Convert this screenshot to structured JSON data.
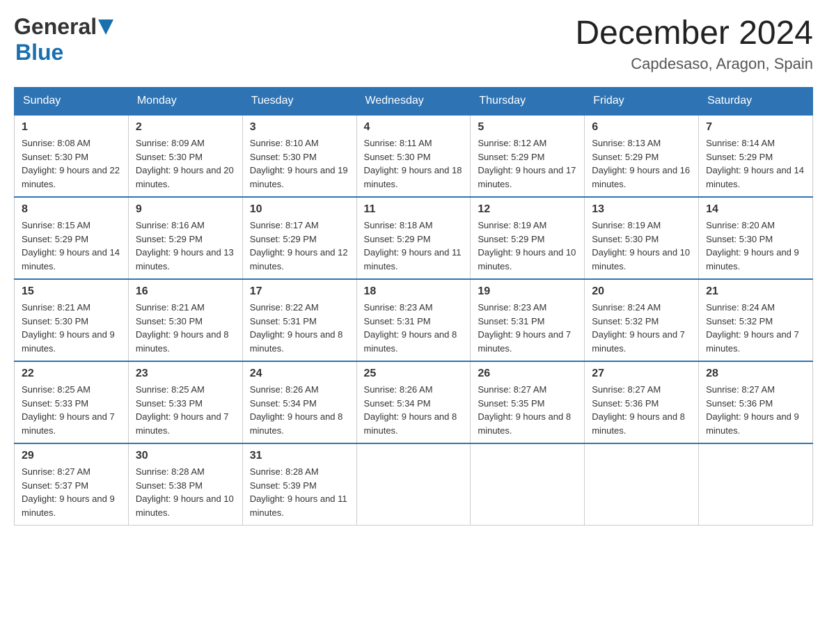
{
  "header": {
    "logo_general": "General",
    "logo_blue": "Blue",
    "month_title": "December 2024",
    "location": "Capdesaso, Aragon, Spain"
  },
  "weekdays": [
    "Sunday",
    "Monday",
    "Tuesday",
    "Wednesday",
    "Thursday",
    "Friday",
    "Saturday"
  ],
  "weeks": [
    [
      {
        "day": "1",
        "sunrise": "8:08 AM",
        "sunset": "5:30 PM",
        "daylight": "9 hours and 22 minutes."
      },
      {
        "day": "2",
        "sunrise": "8:09 AM",
        "sunset": "5:30 PM",
        "daylight": "9 hours and 20 minutes."
      },
      {
        "day": "3",
        "sunrise": "8:10 AM",
        "sunset": "5:30 PM",
        "daylight": "9 hours and 19 minutes."
      },
      {
        "day": "4",
        "sunrise": "8:11 AM",
        "sunset": "5:30 PM",
        "daylight": "9 hours and 18 minutes."
      },
      {
        "day": "5",
        "sunrise": "8:12 AM",
        "sunset": "5:29 PM",
        "daylight": "9 hours and 17 minutes."
      },
      {
        "day": "6",
        "sunrise": "8:13 AM",
        "sunset": "5:29 PM",
        "daylight": "9 hours and 16 minutes."
      },
      {
        "day": "7",
        "sunrise": "8:14 AM",
        "sunset": "5:29 PM",
        "daylight": "9 hours and 14 minutes."
      }
    ],
    [
      {
        "day": "8",
        "sunrise": "8:15 AM",
        "sunset": "5:29 PM",
        "daylight": "9 hours and 14 minutes."
      },
      {
        "day": "9",
        "sunrise": "8:16 AM",
        "sunset": "5:29 PM",
        "daylight": "9 hours and 13 minutes."
      },
      {
        "day": "10",
        "sunrise": "8:17 AM",
        "sunset": "5:29 PM",
        "daylight": "9 hours and 12 minutes."
      },
      {
        "day": "11",
        "sunrise": "8:18 AM",
        "sunset": "5:29 PM",
        "daylight": "9 hours and 11 minutes."
      },
      {
        "day": "12",
        "sunrise": "8:19 AM",
        "sunset": "5:29 PM",
        "daylight": "9 hours and 10 minutes."
      },
      {
        "day": "13",
        "sunrise": "8:19 AM",
        "sunset": "5:30 PM",
        "daylight": "9 hours and 10 minutes."
      },
      {
        "day": "14",
        "sunrise": "8:20 AM",
        "sunset": "5:30 PM",
        "daylight": "9 hours and 9 minutes."
      }
    ],
    [
      {
        "day": "15",
        "sunrise": "8:21 AM",
        "sunset": "5:30 PM",
        "daylight": "9 hours and 9 minutes."
      },
      {
        "day": "16",
        "sunrise": "8:21 AM",
        "sunset": "5:30 PM",
        "daylight": "9 hours and 8 minutes."
      },
      {
        "day": "17",
        "sunrise": "8:22 AM",
        "sunset": "5:31 PM",
        "daylight": "9 hours and 8 minutes."
      },
      {
        "day": "18",
        "sunrise": "8:23 AM",
        "sunset": "5:31 PM",
        "daylight": "9 hours and 8 minutes."
      },
      {
        "day": "19",
        "sunrise": "8:23 AM",
        "sunset": "5:31 PM",
        "daylight": "9 hours and 7 minutes."
      },
      {
        "day": "20",
        "sunrise": "8:24 AM",
        "sunset": "5:32 PM",
        "daylight": "9 hours and 7 minutes."
      },
      {
        "day": "21",
        "sunrise": "8:24 AM",
        "sunset": "5:32 PM",
        "daylight": "9 hours and 7 minutes."
      }
    ],
    [
      {
        "day": "22",
        "sunrise": "8:25 AM",
        "sunset": "5:33 PM",
        "daylight": "9 hours and 7 minutes."
      },
      {
        "day": "23",
        "sunrise": "8:25 AM",
        "sunset": "5:33 PM",
        "daylight": "9 hours and 7 minutes."
      },
      {
        "day": "24",
        "sunrise": "8:26 AM",
        "sunset": "5:34 PM",
        "daylight": "9 hours and 8 minutes."
      },
      {
        "day": "25",
        "sunrise": "8:26 AM",
        "sunset": "5:34 PM",
        "daylight": "9 hours and 8 minutes."
      },
      {
        "day": "26",
        "sunrise": "8:27 AM",
        "sunset": "5:35 PM",
        "daylight": "9 hours and 8 minutes."
      },
      {
        "day": "27",
        "sunrise": "8:27 AM",
        "sunset": "5:36 PM",
        "daylight": "9 hours and 8 minutes."
      },
      {
        "day": "28",
        "sunrise": "8:27 AM",
        "sunset": "5:36 PM",
        "daylight": "9 hours and 9 minutes."
      }
    ],
    [
      {
        "day": "29",
        "sunrise": "8:27 AM",
        "sunset": "5:37 PM",
        "daylight": "9 hours and 9 minutes."
      },
      {
        "day": "30",
        "sunrise": "8:28 AM",
        "sunset": "5:38 PM",
        "daylight": "9 hours and 10 minutes."
      },
      {
        "day": "31",
        "sunrise": "8:28 AM",
        "sunset": "5:39 PM",
        "daylight": "9 hours and 11 minutes."
      },
      null,
      null,
      null,
      null
    ]
  ]
}
